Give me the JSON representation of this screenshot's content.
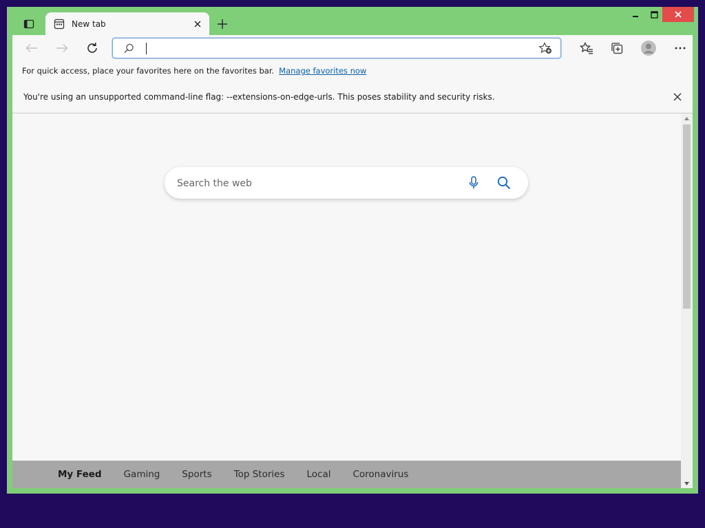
{
  "tab": {
    "title": "New tab"
  },
  "toolbar": {
    "address_value": ""
  },
  "favorites_bar": {
    "message": "For quick access, place your favorites here on the favorites bar.",
    "link": "Manage favorites now"
  },
  "infobar": {
    "message": "You're using an unsupported command-line flag: --extensions-on-edge-urls. This poses stability and security risks."
  },
  "search": {
    "placeholder": "Search the web"
  },
  "feed": {
    "items": [
      "My Feed",
      "Gaming",
      "Sports",
      "Top Stories",
      "Local",
      "Coronavirus"
    ]
  },
  "colors": {
    "frame": "#7ecf78",
    "desktop": "#1f0a5c",
    "close_button": "#e44b4b",
    "link": "#0b5fa5",
    "search_icon": "#1565c0"
  }
}
